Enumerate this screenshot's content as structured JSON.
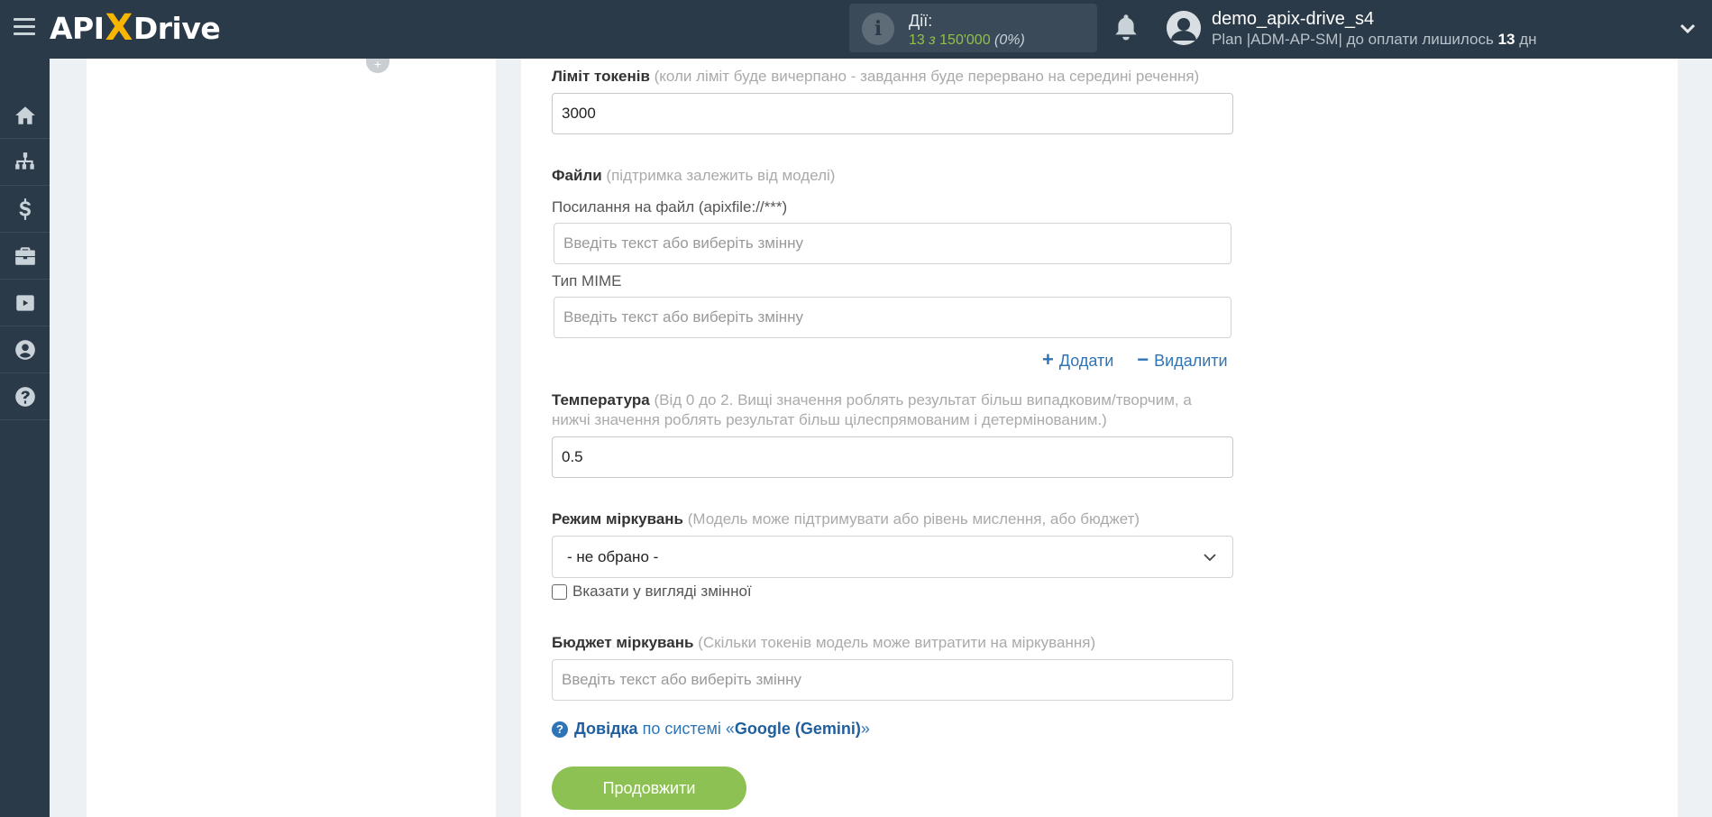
{
  "header": {
    "logo_left": "API",
    "logo_x": "X",
    "logo_right": "Drive",
    "actions_title": "Дії:",
    "actions_used": "13",
    "actions_sep": "з",
    "actions_total": "150'000",
    "actions_pct": "(0%)",
    "user_name": "demo_apix-drive_s4",
    "plan_prefix": "Plan |ADM-AP-SM| до оплати лишилось",
    "plan_days": "13",
    "plan_suffix": "дн"
  },
  "sidebar": {
    "items": [
      "home-icon",
      "sitemap-icon",
      "dollar-icon",
      "briefcase-icon",
      "youtube-icon",
      "user-circle-icon",
      "help-icon"
    ]
  },
  "form": {
    "token_limit_label": "Ліміт токенів",
    "token_limit_hint": "(коли ліміт буде вичерпано - завдання буде перервано на середині речення)",
    "token_limit_value": "3000",
    "files_label": "Файли",
    "files_hint": "(підтримка залежить від моделі)",
    "file_link_label": "Посилання на файл (apixfile://***)",
    "file_link_placeholder": "Введіть текст або виберіть змінну",
    "mime_label": "Тип MIME",
    "mime_placeholder": "Введіть текст або виберіть змінну",
    "add_label": "Додати",
    "remove_label": "Видалити",
    "temperature_label": "Температура",
    "temperature_hint_1": "(Від 0 до 2. Вищі значення роблять результат більш випадковим/творчим, а",
    "temperature_hint_2": "нижчі значення роблять результат більш цілеспрямованим і детермінованим.)",
    "temperature_value": "0.5",
    "reasoning_mode_label": "Режим міркувань",
    "reasoning_mode_hint": "(Модель може підтримувати або рівень мислення, або бюджет)",
    "reasoning_mode_value": "- не обрано -",
    "as_variable_label": "Вказати у вигляді змінної",
    "reasoning_budget_label": "Бюджет міркувань",
    "reasoning_budget_hint": "(Скільки токенів модель може витратити на міркування)",
    "reasoning_budget_placeholder": "Введіть текст або виберіть змінну",
    "help_link": "Довідка",
    "help_middle": "по системі «",
    "help_system": "Google (Gemini)",
    "help_end": "»",
    "continue_label": "Продовжити"
  },
  "colors": {
    "topbar": "#2b3a48",
    "accent_green": "#8dc153",
    "link_blue": "#2f74b5"
  }
}
